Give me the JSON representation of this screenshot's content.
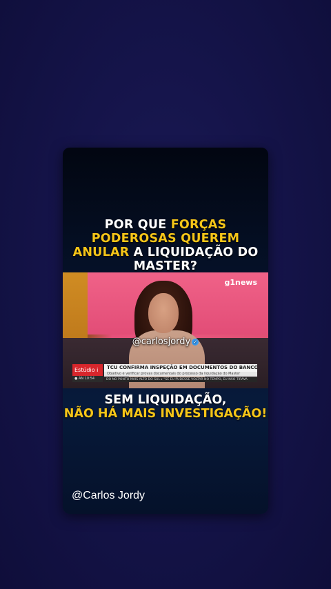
{
  "headline": {
    "part1": "POR QUE ",
    "part2": "FORÇAS PODEROSAS QUEREM ANULAR",
    "part3": " A LIQUIDAÇÃO DO MASTER?"
  },
  "video": {
    "channel_logo": "g1news",
    "watermark": "@carlosjordy",
    "brand": "Estúdio i",
    "brand_time": "● AN   10:54",
    "headline": "TCU CONFIRMA INSPEÇÃO EM DOCUMENTOS DO BANCO CENTRAL",
    "subheadline": "Objetivo é verificar provas documentais do processo da liquidação do Master",
    "ticker": "DO NO PONTO MAIS ALTO DO SUL   ▸ \"SE EU PUDESSE VOLTAR NO TEMPO, EU NÃO TIRAVA"
  },
  "subheadline": {
    "line1": "SEM LIQUIDAÇÃO,",
    "line2": "NÃO HÁ MAIS INVESTIGAÇÃO!"
  },
  "handle": "@Carlos Jordy",
  "colors": {
    "highlight": "#f5c518",
    "background": "#15144a"
  }
}
